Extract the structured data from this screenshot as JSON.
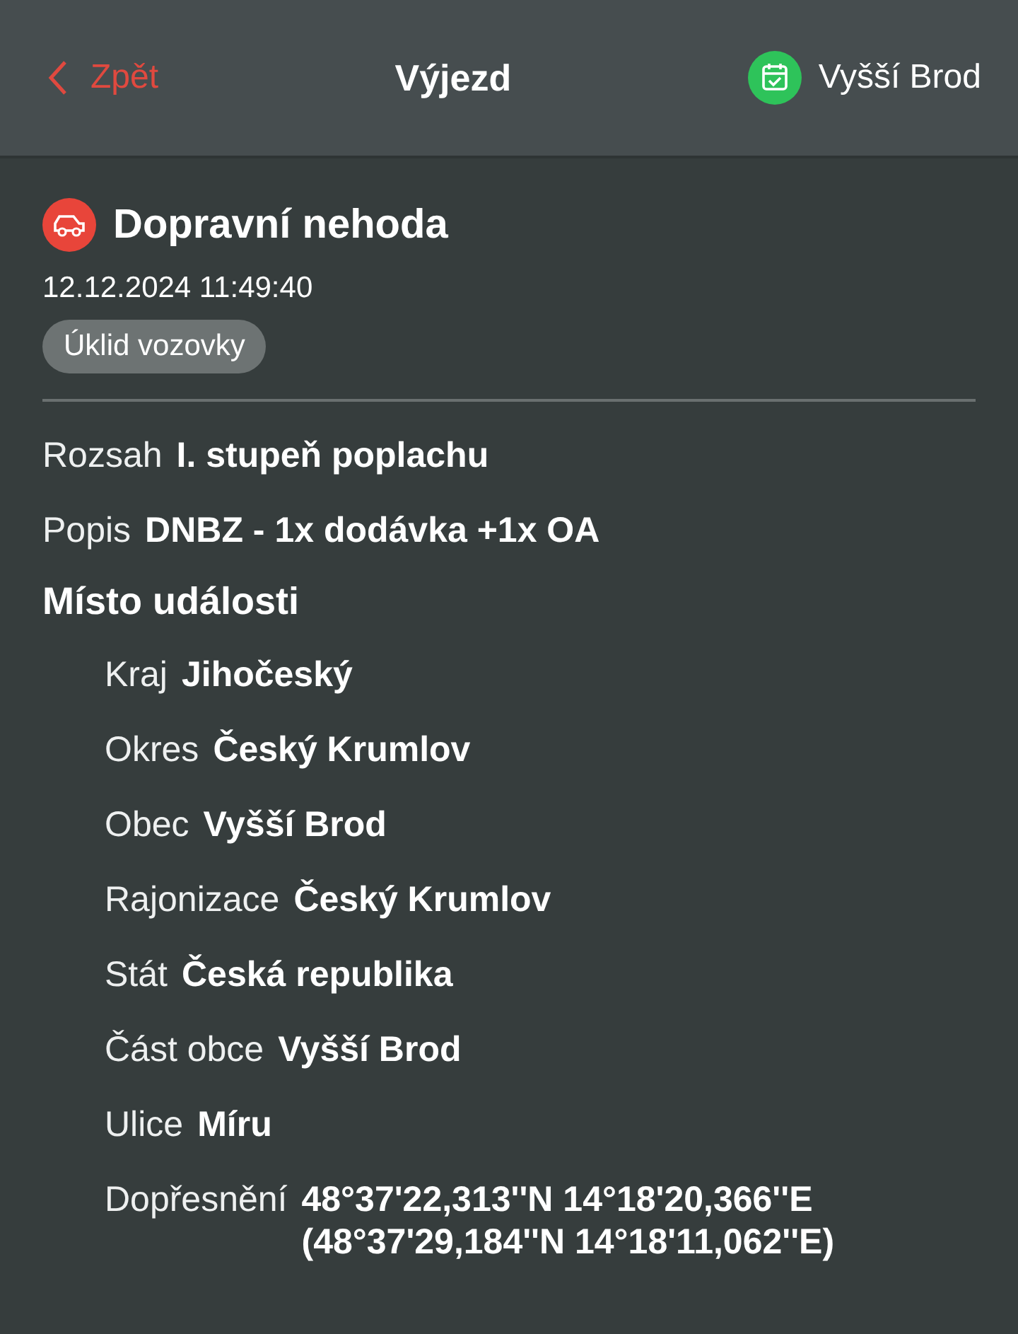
{
  "header": {
    "back": "Zpět",
    "title": "Výjezd",
    "unit": "Vyšší Brod"
  },
  "incident": {
    "title": "Dopravní nehoda",
    "time": "12.12.2024 11:49:40",
    "tag": "Úklid vozovky"
  },
  "fields": [
    {
      "label": "Rozsah",
      "value": "I. stupeň poplachu"
    },
    {
      "label": "Popis",
      "value": "DNBZ - 1x dodávka +1x OA"
    }
  ],
  "location": {
    "heading": "Místo události",
    "fields": [
      {
        "label": "Kraj",
        "value": "Jihočeský"
      },
      {
        "label": "Okres",
        "value": "Český Krumlov"
      },
      {
        "label": "Obec",
        "value": "Vyšší Brod"
      },
      {
        "label": "Rajonizace",
        "value": "Český Krumlov"
      },
      {
        "label": "Stát",
        "value": "Česká republika"
      },
      {
        "label": "Část obce",
        "value": "Vyšší Brod"
      },
      {
        "label": "Ulice",
        "value": "Míru"
      },
      {
        "label": "Dopřesnění",
        "value": "48°37'22,313''N 14°18'20,366''E\n(48°37'29,184''N 14°18'11,062''E)"
      }
    ]
  }
}
